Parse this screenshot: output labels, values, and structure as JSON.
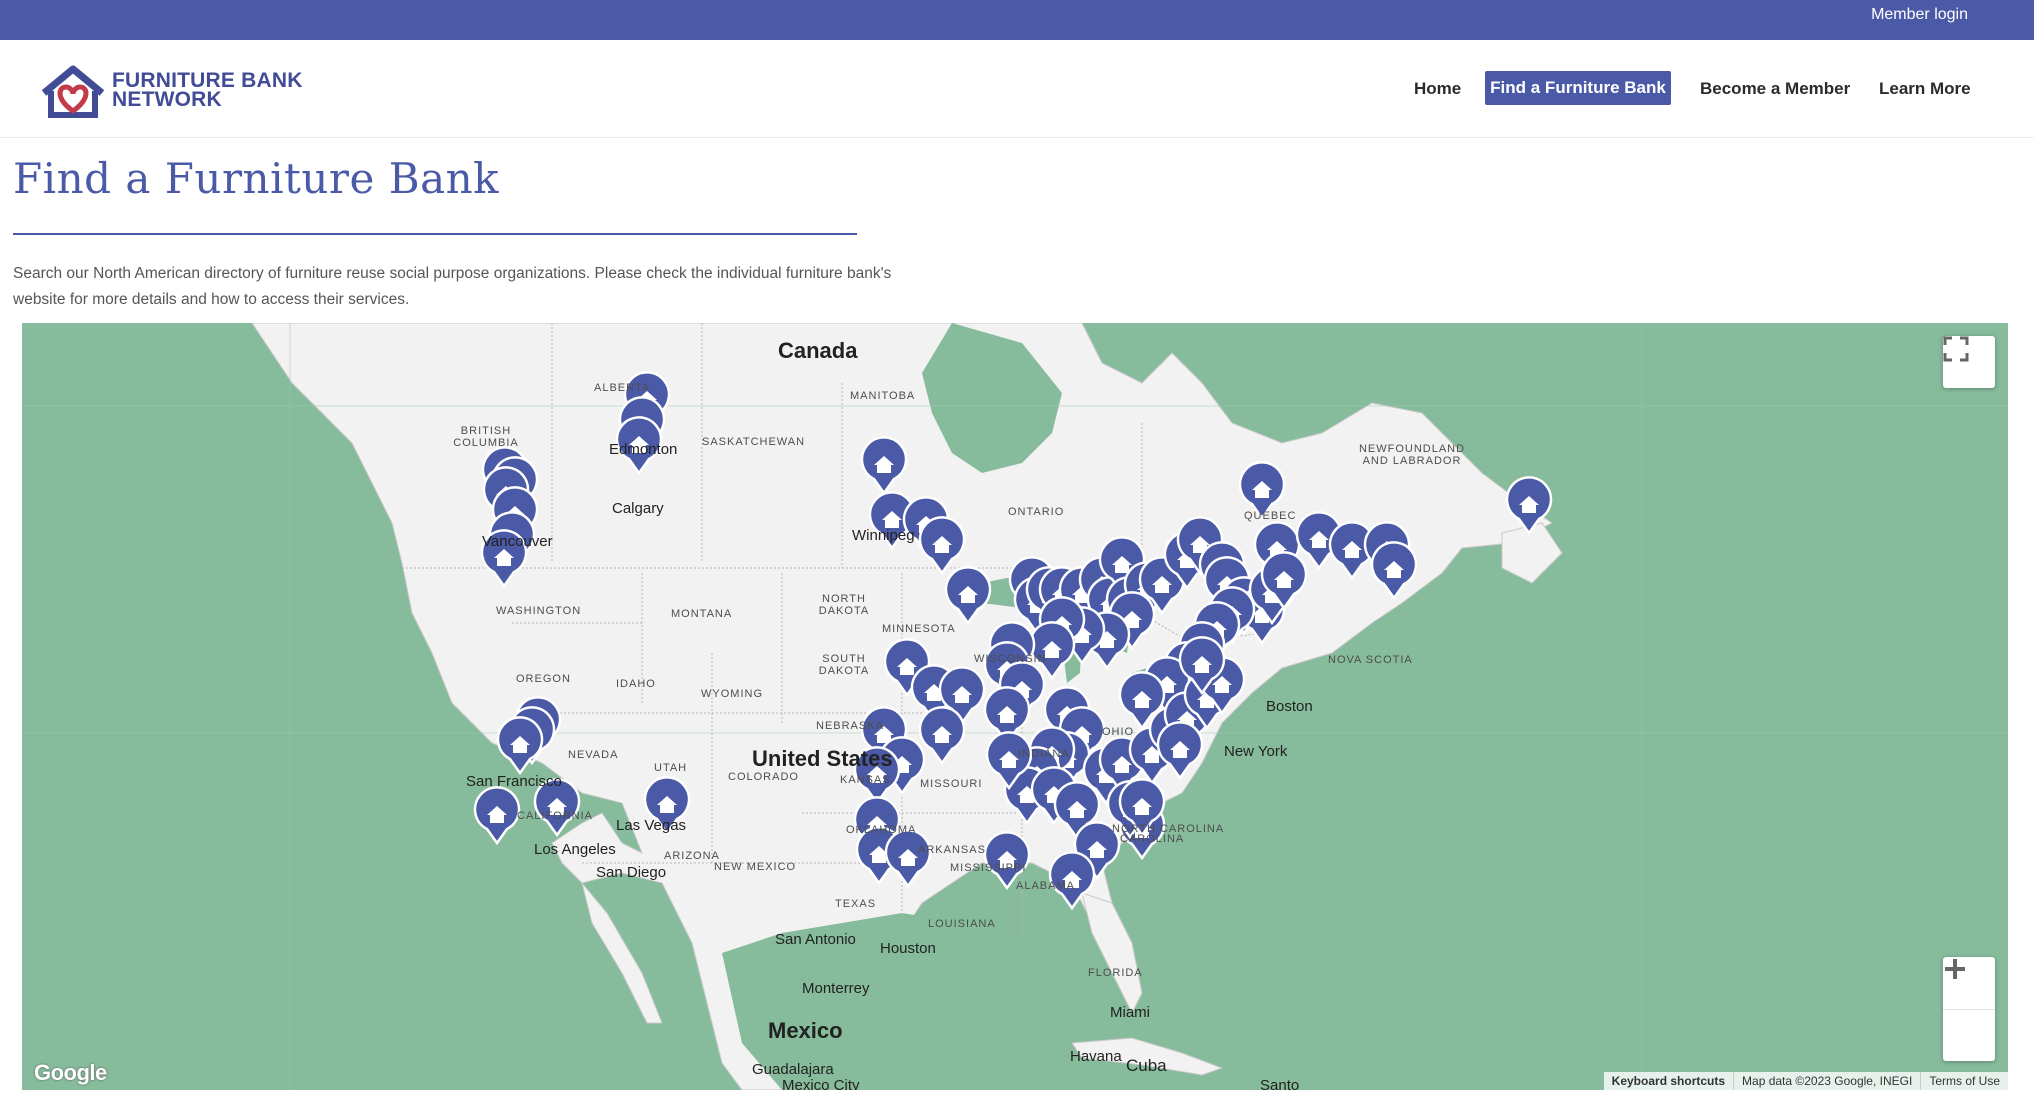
{
  "topbar": {
    "member_login": "Member login"
  },
  "brand": {
    "line1": "FURNITURE BANK",
    "line2": "NETWORK"
  },
  "nav": {
    "home": "Home",
    "find": "Find a Furniture Bank",
    "member": "Become a Member",
    "learn": "Learn More"
  },
  "page": {
    "title": "Find a Furniture Bank",
    "intro": "Search our North American directory of furniture reuse social purpose organizations. Please check the individual furniture bank's website for more details and how to access their services."
  },
  "map": {
    "countries": {
      "canada": "Canada",
      "us": "United States",
      "mexico": "Mexico",
      "cuba": "Cuba"
    },
    "regions": {
      "bc": "BRITISH COLUMBIA",
      "alberta": "ALBERTA",
      "sask": "SASKATCHEWAN",
      "manitoba": "MANITOBA",
      "ontario": "ONTARIO",
      "quebec": "QUEBEC",
      "nl": "NEWFOUNDLAND AND LABRADOR",
      "ns": "NOVA SCOTIA",
      "washington": "WASHINGTON",
      "oregon": "OREGON",
      "idaho": "IDAHO",
      "montana": "MONTANA",
      "wyoming": "WYOMING",
      "nd": "NORTH DAKOTA",
      "sd": "SOUTH DAKOTA",
      "nebraska": "NEBRASKA",
      "nevada": "NEVADA",
      "utah": "UTAH",
      "colorado": "COLORADO",
      "california": "CALIFORNIA",
      "arizona": "ARIZONA",
      "newmexico": "NEW MEXICO",
      "texas": "TEXAS",
      "oklahoma": "OKLAHOMA",
      "arkansas": "ARKANSAS",
      "mississippi": "MISSISSIPPI",
      "louisiana": "LOUISIANA",
      "alabama": "ALABAMA",
      "florida": "FLORIDA",
      "missouri": "MISSOURI",
      "indiana": "INDIANA",
      "ohio": "OHIO",
      "wisconsin": "WISCONSIN",
      "minnesota": "MINNESOTA",
      "nc": "NORTH CAROLINA",
      "carolina": "CAROLINA",
      "kansas": "KANSAS"
    },
    "cities": {
      "edmonton": "Edmonton",
      "calgary": "Calgary",
      "winnipeg": "Winnipeg",
      "vancouver": "Vancouver",
      "boston": "Boston",
      "newyork": "New York",
      "sanfrancisco": "San Francisco",
      "losangeles": "Los Angeles",
      "lasvegas": "Las Vegas",
      "sandiego": "San Diego",
      "sanantonio": "San Antonio",
      "houston": "Houston",
      "monterrey": "Monterrey",
      "miami": "Miami",
      "havana": "Havana",
      "guadalajara": "Guadalajara",
      "mexicocity": "Mexico City",
      "santo": "Santo"
    },
    "attribution": {
      "keyboard": "Keyboard shortcuts",
      "mapdata": "Map data ©2023 Google, INEGI",
      "terms": "Terms of Use"
    },
    "google": "Google",
    "colors": {
      "water": "#86bb9c",
      "land": "#f2f2f2",
      "pin": "#4b5aa6"
    },
    "icons": {
      "fullscreen": "fullscreen-icon",
      "zoom_in": "plus-icon",
      "zoom_out": "minus-icon",
      "pin": "home-marker-icon"
    }
  }
}
